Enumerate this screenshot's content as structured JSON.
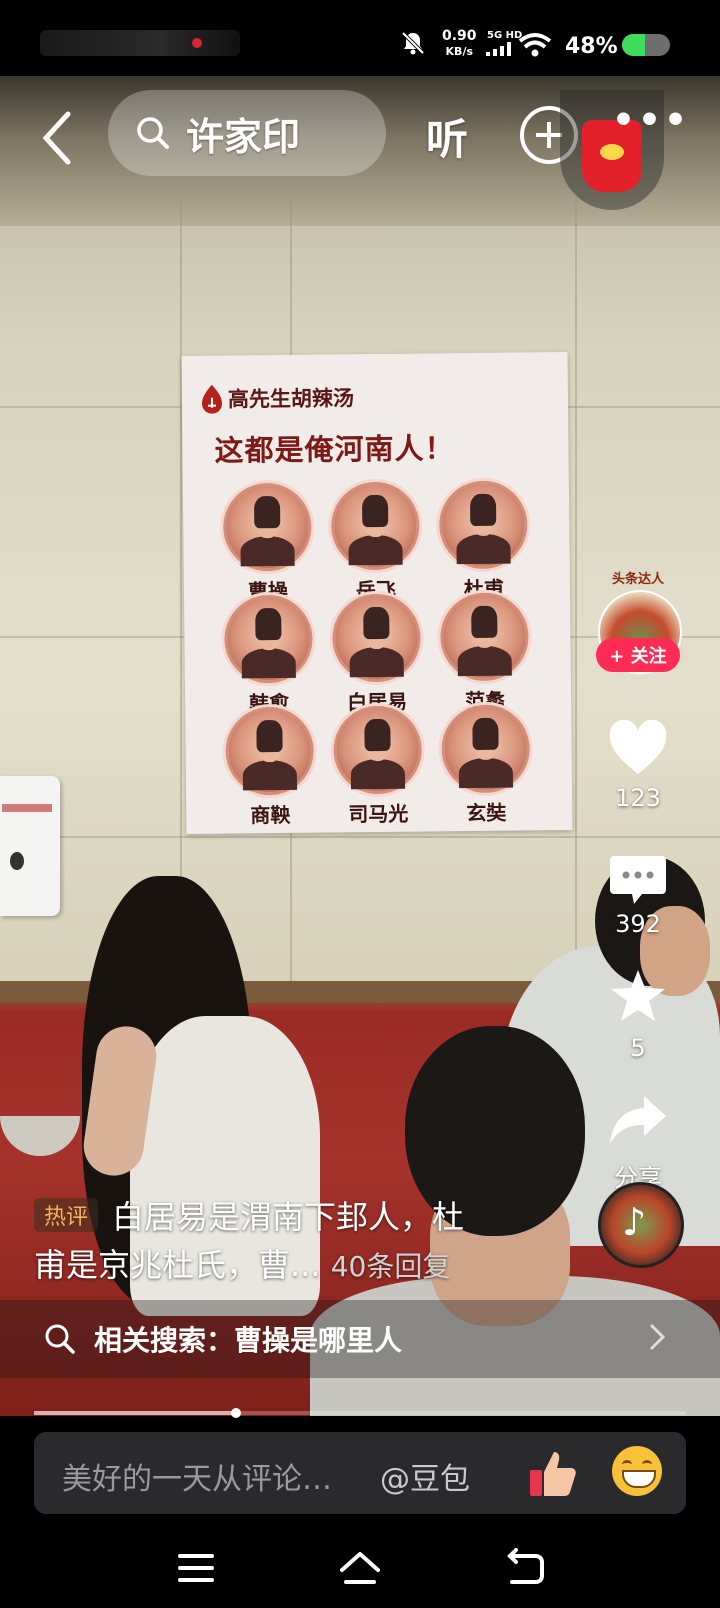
{
  "status_bar": {
    "speed_value": "0.90",
    "speed_unit": "KB/s",
    "network": "5G HD",
    "battery": "48%",
    "battery_level": 0.48
  },
  "top_bar": {
    "search_query": "许家印",
    "listen_label": "听",
    "icons": [
      "back-arrow-icon",
      "search-icon",
      "plus-circle-icon",
      "more-icon",
      "red-packet-icon"
    ]
  },
  "poster": {
    "brand": "高先生胡辣汤",
    "headline": "这都是俺河南人！",
    "names": [
      "曹操",
      "岳飞",
      "杜甫",
      "韩愈",
      "白居易",
      "范蠡",
      "商鞅",
      "司马光",
      "玄奘"
    ]
  },
  "right_rail": {
    "avatar_banner": "头条达人",
    "follow_label": "+ 关注",
    "like_count": "123",
    "comment_count": "392",
    "favorite_count": "5",
    "share_label": "分享"
  },
  "hot_comment": {
    "tag": "热评",
    "line1": "白居易是渭南下邽人，杜",
    "line2": "甫是京兆杜氏，曹...",
    "replies": "40条回复"
  },
  "related_search": {
    "label": "相关搜索：曹操是哪里人"
  },
  "playback": {
    "progress": 0.31
  },
  "comment_input": {
    "placeholder": "美好的一天从评论…",
    "mention": "@豆包"
  },
  "nav_bar": {
    "icons": [
      "menu-icon",
      "home-icon",
      "back-icon"
    ]
  },
  "colors": {
    "accent": "#fe2c55",
    "hot_tag": "#f2b25b",
    "poster_red": "#7d1a17"
  }
}
